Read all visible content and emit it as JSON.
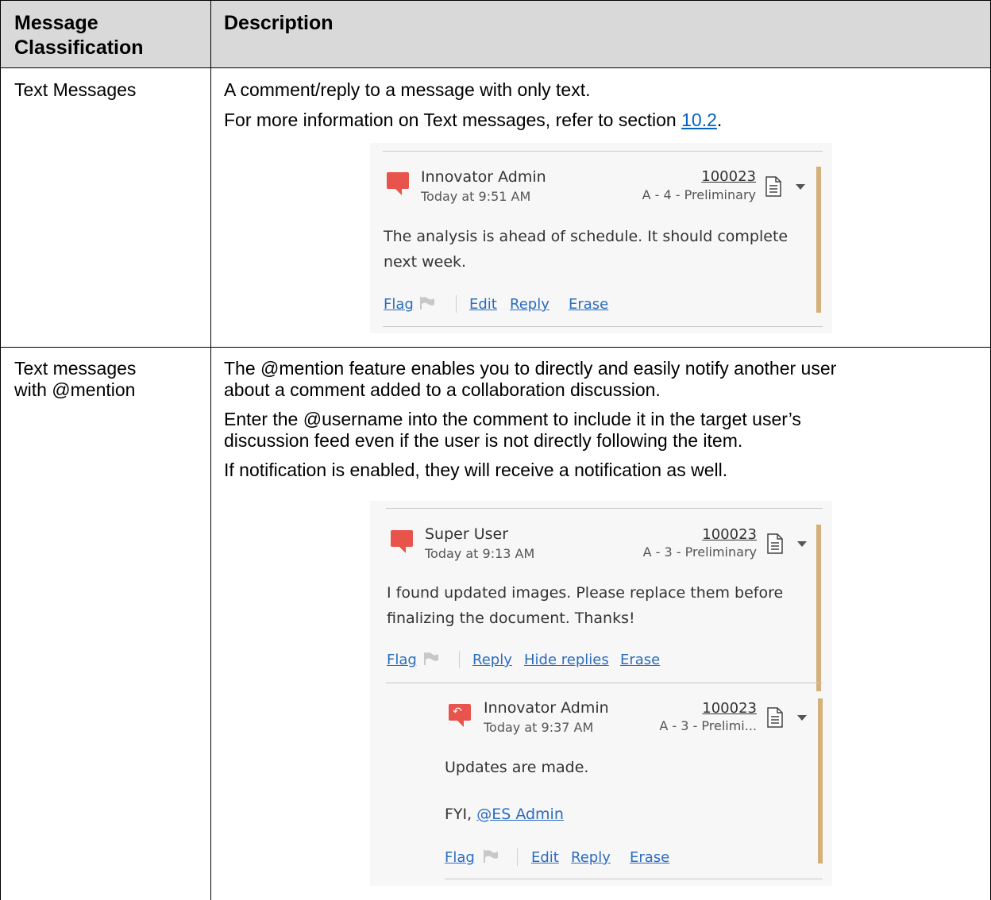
{
  "table": {
    "headers": [
      "Message Classification",
      "Description"
    ],
    "header_col1_lines": [
      "Message",
      "Classification"
    ],
    "rows": [
      {
        "classification": "Text Messages",
        "description": [
          "A comment/reply to a message with only text."
        ],
        "reference_prefix": "For more information on Text messages, refer to section ",
        "reference_link": "10.2",
        "reference_suffix": "."
      },
      {
        "classification_lines": [
          "Text messages",
          "with @mention"
        ],
        "description_lines": [
          "The @mention feature enables you to directly and easily notify another user",
          "about a comment added to a collaboration discussion.",
          "Enter the @username into the comment to include it in the target user’s",
          "discussion feed even if the user is not directly following the item.",
          "If notification is enabled, they will receive a notification as well."
        ]
      }
    ]
  },
  "card1": {
    "author": "Innovator Admin",
    "time": "Today at 9:51 AM",
    "item_number": "100023",
    "item_revision": "A - 4 - Preliminary",
    "body_lines": [
      "The analysis is ahead of schedule. It should complete",
      "next week."
    ],
    "actions": {
      "flag": "Flag",
      "edit": "Edit",
      "reply": "Reply",
      "erase": "Erase"
    },
    "icons": {
      "message": "message-bubble-icon",
      "document": "document-icon",
      "menu": "chevron-down-icon",
      "flag": "flag-icon"
    }
  },
  "card2": {
    "author": "Super User",
    "time": "Today at 9:13 AM",
    "item_number": "100023",
    "item_revision": "A - 3 - Preliminary",
    "body_lines": [
      "I found updated images. Please replace them before",
      "finalizing the document. Thanks!"
    ],
    "actions": {
      "flag": "Flag",
      "reply": "Reply",
      "hide_replies": "Hide replies",
      "erase": "Erase"
    }
  },
  "card3": {
    "author": "Innovator Admin",
    "time": "Today at 9:37 AM",
    "item_number": "100023",
    "item_revision": "A - 3 - Prelimi...",
    "body_line1": "Updates are made.",
    "body_prefix": "FYI, ",
    "mention": "@ES Admin",
    "actions": {
      "flag": "Flag",
      "edit": "Edit",
      "reply": "Reply",
      "erase": "Erase"
    }
  },
  "colors": {
    "header_bg": "#d9d9d9",
    "link": "#0563c1",
    "ui_link": "#2b6cbf",
    "bubble": "#e8534b",
    "accent_bar": "#d4b07a",
    "card_bg": "#f7f7f7"
  }
}
